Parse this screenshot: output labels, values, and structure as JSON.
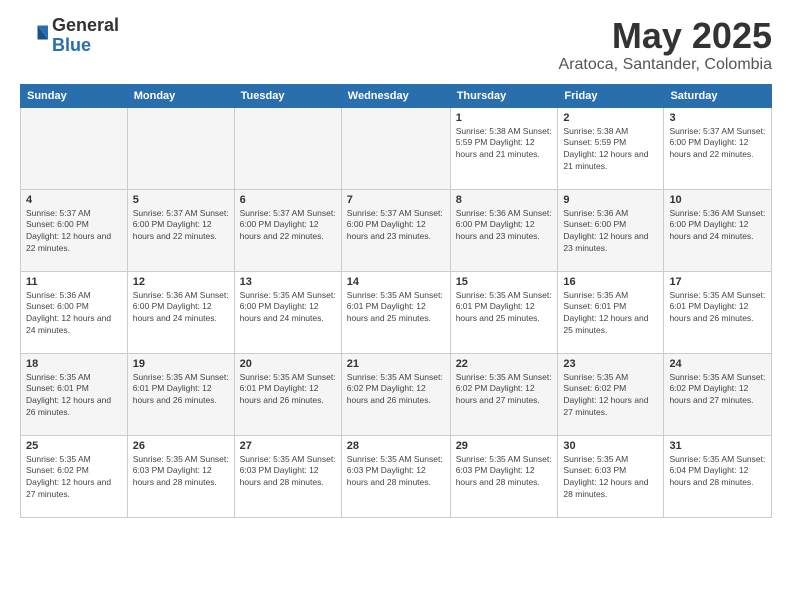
{
  "logo": {
    "general": "General",
    "blue": "Blue"
  },
  "header": {
    "title": "May 2025",
    "subtitle": "Aratoca, Santander, Colombia"
  },
  "days_of_week": [
    "Sunday",
    "Monday",
    "Tuesday",
    "Wednesday",
    "Thursday",
    "Friday",
    "Saturday"
  ],
  "weeks": [
    [
      {
        "day": "",
        "info": ""
      },
      {
        "day": "",
        "info": ""
      },
      {
        "day": "",
        "info": ""
      },
      {
        "day": "",
        "info": ""
      },
      {
        "day": "1",
        "info": "Sunrise: 5:38 AM\nSunset: 5:59 PM\nDaylight: 12 hours\nand 21 minutes."
      },
      {
        "day": "2",
        "info": "Sunrise: 5:38 AM\nSunset: 5:59 PM\nDaylight: 12 hours\nand 21 minutes."
      },
      {
        "day": "3",
        "info": "Sunrise: 5:37 AM\nSunset: 6:00 PM\nDaylight: 12 hours\nand 22 minutes."
      }
    ],
    [
      {
        "day": "4",
        "info": "Sunrise: 5:37 AM\nSunset: 6:00 PM\nDaylight: 12 hours\nand 22 minutes."
      },
      {
        "day": "5",
        "info": "Sunrise: 5:37 AM\nSunset: 6:00 PM\nDaylight: 12 hours\nand 22 minutes."
      },
      {
        "day": "6",
        "info": "Sunrise: 5:37 AM\nSunset: 6:00 PM\nDaylight: 12 hours\nand 22 minutes."
      },
      {
        "day": "7",
        "info": "Sunrise: 5:37 AM\nSunset: 6:00 PM\nDaylight: 12 hours\nand 23 minutes."
      },
      {
        "day": "8",
        "info": "Sunrise: 5:36 AM\nSunset: 6:00 PM\nDaylight: 12 hours\nand 23 minutes."
      },
      {
        "day": "9",
        "info": "Sunrise: 5:36 AM\nSunset: 6:00 PM\nDaylight: 12 hours\nand 23 minutes."
      },
      {
        "day": "10",
        "info": "Sunrise: 5:36 AM\nSunset: 6:00 PM\nDaylight: 12 hours\nand 24 minutes."
      }
    ],
    [
      {
        "day": "11",
        "info": "Sunrise: 5:36 AM\nSunset: 6:00 PM\nDaylight: 12 hours\nand 24 minutes."
      },
      {
        "day": "12",
        "info": "Sunrise: 5:36 AM\nSunset: 6:00 PM\nDaylight: 12 hours\nand 24 minutes."
      },
      {
        "day": "13",
        "info": "Sunrise: 5:35 AM\nSunset: 6:00 PM\nDaylight: 12 hours\nand 24 minutes."
      },
      {
        "day": "14",
        "info": "Sunrise: 5:35 AM\nSunset: 6:01 PM\nDaylight: 12 hours\nand 25 minutes."
      },
      {
        "day": "15",
        "info": "Sunrise: 5:35 AM\nSunset: 6:01 PM\nDaylight: 12 hours\nand 25 minutes."
      },
      {
        "day": "16",
        "info": "Sunrise: 5:35 AM\nSunset: 6:01 PM\nDaylight: 12 hours\nand 25 minutes."
      },
      {
        "day": "17",
        "info": "Sunrise: 5:35 AM\nSunset: 6:01 PM\nDaylight: 12 hours\nand 26 minutes."
      }
    ],
    [
      {
        "day": "18",
        "info": "Sunrise: 5:35 AM\nSunset: 6:01 PM\nDaylight: 12 hours\nand 26 minutes."
      },
      {
        "day": "19",
        "info": "Sunrise: 5:35 AM\nSunset: 6:01 PM\nDaylight: 12 hours\nand 26 minutes."
      },
      {
        "day": "20",
        "info": "Sunrise: 5:35 AM\nSunset: 6:01 PM\nDaylight: 12 hours\nand 26 minutes."
      },
      {
        "day": "21",
        "info": "Sunrise: 5:35 AM\nSunset: 6:02 PM\nDaylight: 12 hours\nand 26 minutes."
      },
      {
        "day": "22",
        "info": "Sunrise: 5:35 AM\nSunset: 6:02 PM\nDaylight: 12 hours\nand 27 minutes."
      },
      {
        "day": "23",
        "info": "Sunrise: 5:35 AM\nSunset: 6:02 PM\nDaylight: 12 hours\nand 27 minutes."
      },
      {
        "day": "24",
        "info": "Sunrise: 5:35 AM\nSunset: 6:02 PM\nDaylight: 12 hours\nand 27 minutes."
      }
    ],
    [
      {
        "day": "25",
        "info": "Sunrise: 5:35 AM\nSunset: 6:02 PM\nDaylight: 12 hours\nand 27 minutes."
      },
      {
        "day": "26",
        "info": "Sunrise: 5:35 AM\nSunset: 6:03 PM\nDaylight: 12 hours\nand 28 minutes."
      },
      {
        "day": "27",
        "info": "Sunrise: 5:35 AM\nSunset: 6:03 PM\nDaylight: 12 hours\nand 28 minutes."
      },
      {
        "day": "28",
        "info": "Sunrise: 5:35 AM\nSunset: 6:03 PM\nDaylight: 12 hours\nand 28 minutes."
      },
      {
        "day": "29",
        "info": "Sunrise: 5:35 AM\nSunset: 6:03 PM\nDaylight: 12 hours\nand 28 minutes."
      },
      {
        "day": "30",
        "info": "Sunrise: 5:35 AM\nSunset: 6:03 PM\nDaylight: 12 hours\nand 28 minutes."
      },
      {
        "day": "31",
        "info": "Sunrise: 5:35 AM\nSunset: 6:04 PM\nDaylight: 12 hours\nand 28 minutes."
      }
    ]
  ]
}
